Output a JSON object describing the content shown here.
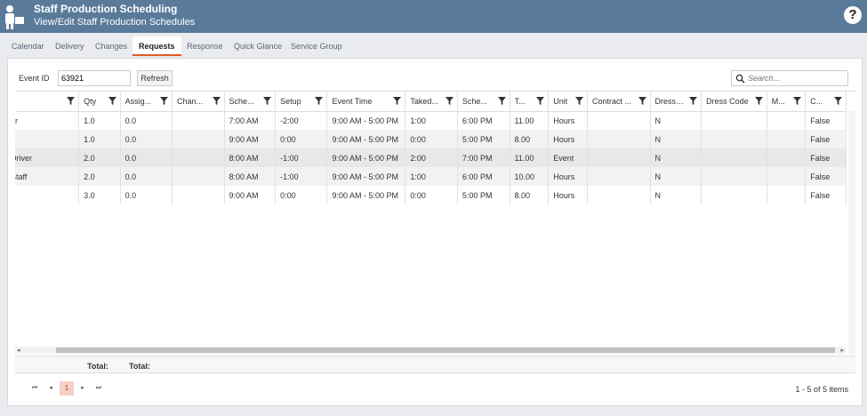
{
  "header": {
    "title": "Staff Production Scheduling",
    "subtitle": "View/Edit Staff Production Schedules",
    "help_label": "?"
  },
  "tabs": [
    {
      "label": "Calendar"
    },
    {
      "label": "Delivery"
    },
    {
      "label": "Changes"
    },
    {
      "label": "Requests"
    },
    {
      "label": "Response"
    },
    {
      "label": "Quick Glance"
    },
    {
      "label": "Service Group"
    }
  ],
  "active_tab": "Requests",
  "toolbar": {
    "event_id_label": "Event ID",
    "event_id_value": "63921",
    "refresh_label": "Refresh",
    "search_placeholder": "Search..."
  },
  "grid": {
    "columns": [
      "",
      "Qty",
      "Assig...",
      "Chan...",
      "Sche...",
      "Setup",
      "Event Time",
      "Taked...",
      "Sche...",
      "T...",
      "Unit",
      "Contract ...",
      "Dressed",
      "Dress Code",
      "M...",
      "C..."
    ],
    "rows": [
      [
        "er",
        "1.0",
        "0.0",
        "",
        "7:00 AM",
        "-2:00",
        "9:00 AM - 5:00 PM",
        "1:00",
        "6:00 PM",
        "11.00",
        "Hours",
        "",
        "N",
        "",
        "",
        "False"
      ],
      [
        "",
        "1.0",
        "0.0",
        "",
        "9:00 AM",
        "0:00",
        "9:00 AM - 5:00 PM",
        "0:00",
        "5:00 PM",
        "8.00",
        "Hours",
        "",
        "N",
        "",
        "",
        "False"
      ],
      [
        "Driver",
        "2.0",
        "0.0",
        "",
        "8:00 AM",
        "-1:00",
        "9:00 AM - 5:00 PM",
        "2:00",
        "7:00 PM",
        "11.00",
        "Event",
        "",
        "N",
        "",
        "",
        "False"
      ],
      [
        "Staff",
        "2.0",
        "0.0",
        "",
        "8:00 AM",
        "-1:00",
        "9:00 AM - 5:00 PM",
        "1:00",
        "6:00 PM",
        "10.00",
        "Hours",
        "",
        "N",
        "",
        "",
        "False"
      ],
      [
        "",
        "3.0",
        "0.0",
        "",
        "9:00 AM",
        "0:00",
        "9:00 AM - 5:00 PM",
        "0:00",
        "5:00 PM",
        "8.00",
        "Hours",
        "",
        "N",
        "",
        "",
        "False"
      ]
    ],
    "totals": [
      "Total:",
      "Total:"
    ]
  },
  "pager": {
    "current_page": "1",
    "info": "1 - 5 of 5 items"
  },
  "colors": {
    "header_bg": "#5a7a99",
    "active_tab_underline": "#e05a2b",
    "current_page_bg": "#f7d0c6"
  }
}
